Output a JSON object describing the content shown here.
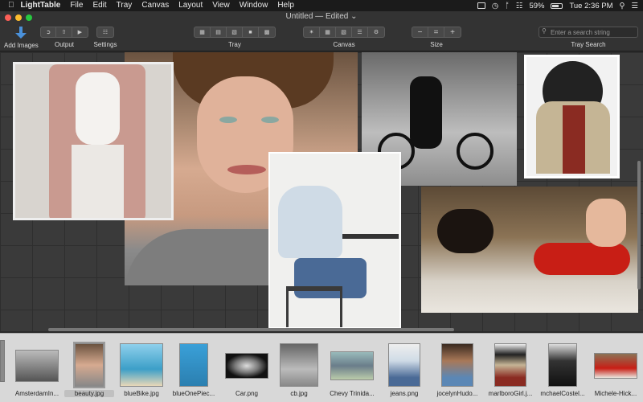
{
  "menubar": {
    "app": "LightTable",
    "items": [
      "File",
      "Edit",
      "Tray",
      "Canvas",
      "Layout",
      "View",
      "Window",
      "Help"
    ],
    "battery": "59%",
    "clock": "Tue 2:36 PM"
  },
  "window": {
    "title": "Untitled — Edited ⌄"
  },
  "toolbar": {
    "add_images": "Add Images",
    "output": "Output",
    "settings": "Settings",
    "tray": "Tray",
    "canvas": "Canvas",
    "size": "Size",
    "tray_search": "Tray Search",
    "search_placeholder": "Enter a search string",
    "size_minus": "−",
    "size_equal": "=",
    "size_plus": "+"
  },
  "tray": {
    "items": [
      {
        "label": "AmsterdamIn..."
      },
      {
        "label": "beauty.jpg",
        "selected": true
      },
      {
        "label": "blueBike.jpg"
      },
      {
        "label": "blueOnePiec..."
      },
      {
        "label": "Car.png"
      },
      {
        "label": "cb.jpg"
      },
      {
        "label": "Chevy Trinida..."
      },
      {
        "label": "jeans.png"
      },
      {
        "label": "jocelynHudo..."
      },
      {
        "label": "marlboroGirl.j..."
      },
      {
        "label": "mchaelCostel..."
      },
      {
        "label": "Michele-Hick..."
      }
    ]
  }
}
